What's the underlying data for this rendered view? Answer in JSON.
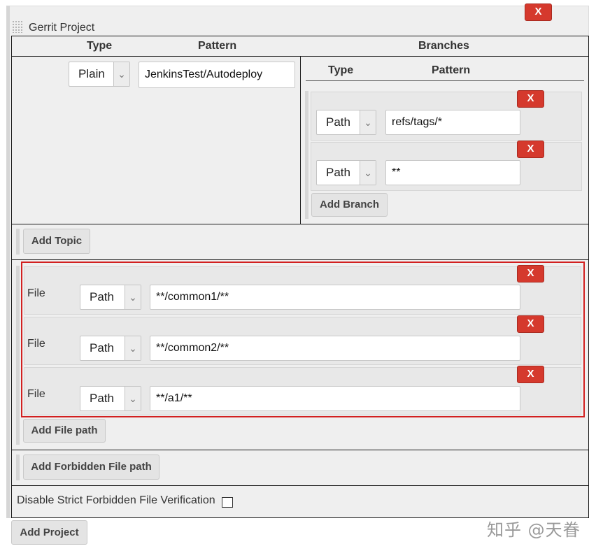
{
  "project": {
    "title": "Gerrit Project",
    "delete_label": "X",
    "table": {
      "type_header": "Type",
      "pattern_header": "Pattern",
      "branches_header": "Branches",
      "project_type": "Plain",
      "project_pattern": "JenkinsTest/Autodeploy"
    },
    "branches": {
      "type_header": "Type",
      "pattern_header": "Pattern",
      "items": [
        {
          "type": "Path",
          "pattern": "refs/tags/*",
          "delete_label": "X"
        },
        {
          "type": "Path",
          "pattern": "**",
          "delete_label": "X"
        }
      ],
      "add_label": "Add Branch"
    },
    "add_topic_label": "Add Topic",
    "file_paths": {
      "items": [
        {
          "label": "File",
          "type": "Path",
          "pattern": "**/common1/**",
          "delete_label": "X"
        },
        {
          "label": "File",
          "type": "Path",
          "pattern": "**/common2/**",
          "delete_label": "X"
        },
        {
          "label": "File",
          "type": "Path",
          "pattern": "**/a1/**",
          "delete_label": "X"
        }
      ],
      "add_label": "Add File path"
    },
    "add_forbidden_label": "Add Forbidden File path",
    "disable_strict_label": "Disable Strict Forbidden File Verification"
  },
  "add_project_label": "Add Project",
  "watermark": "知乎 @天眷",
  "colors": {
    "delete_button": "#d5392d",
    "highlight_border": "#d22020"
  }
}
